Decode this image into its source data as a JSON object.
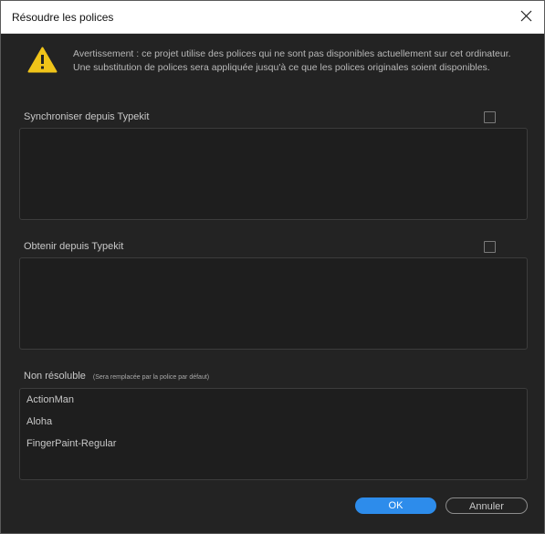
{
  "window": {
    "title": "Résoudre les polices"
  },
  "warning": {
    "icon": "warning-icon",
    "text": "Avertissement : ce projet utilise des polices qui ne sont pas disponibles actuellement sur cet ordinateur. Une substitution de polices sera appliquée jusqu'à ce que les polices originales soient disponibles."
  },
  "sections": {
    "sync": {
      "label": "Synchroniser depuis Typekit",
      "checked": false
    },
    "obtain": {
      "label": "Obtenir depuis Typekit",
      "checked": false
    },
    "unresolvable": {
      "label": "Non résoluble",
      "note": "(Sera remplacée par la police par défaut)",
      "fonts": [
        "ActionMan",
        "Aloha",
        "FingerPaint-Regular"
      ]
    }
  },
  "buttons": {
    "ok": "OK",
    "cancel": "Annuler"
  },
  "colors": {
    "accent": "#2d8ceb",
    "warning": "#f0c419",
    "background": "#232323"
  }
}
